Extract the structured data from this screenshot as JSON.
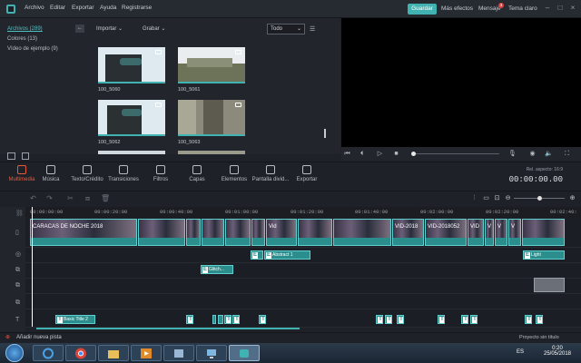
{
  "menubar": {
    "items": [
      "Archivo",
      "Editar",
      "Exportar",
      "Ayuda",
      "Registrarse"
    ],
    "save_label": "Guardar",
    "more_effects": "Más efectos",
    "messages": "Mensaje",
    "messages_badge": "3",
    "theme": "Tema claro"
  },
  "library": {
    "sidebar": [
      "Archivos (289)",
      "Colores (13)",
      "Vídeo de ejemplo (9)"
    ],
    "import_label": "Importar",
    "record_label": "Grabar",
    "filter_value": "Todo",
    "clips": [
      {
        "label": "100_5060"
      },
      {
        "label": "100_5061"
      },
      {
        "label": "100_5062"
      },
      {
        "label": "100_5063"
      }
    ]
  },
  "modules": [
    {
      "label": "Multimedia",
      "active": true
    },
    {
      "label": "Música"
    },
    {
      "label": "Texto/Crédito"
    },
    {
      "label": "Transiciones"
    },
    {
      "label": "Filtros"
    },
    {
      "label": "Capas"
    },
    {
      "label": "Elementos"
    },
    {
      "label": "Pantalla divid..."
    },
    {
      "label": "Exportar"
    }
  ],
  "preview": {
    "aspect_label": "Rel. aspecto: 16:9",
    "timecode": "00:00:00.00"
  },
  "timeline": {
    "ruler": [
      "00:00:00:00",
      "00:00:20:00",
      "00:00:40:00",
      "00:01:00:00",
      "00:01:20:00",
      "00:01:40:00",
      "00:02:00:00",
      "00:02:20:00",
      "00:02:40:"
    ],
    "video_clips": [
      "CARACAS DE NOCHE 2018",
      "",
      "",
      "",
      "",
      "Vid",
      "",
      "",
      "VID-2018",
      "VID-2018052",
      "VID",
      "V",
      "V",
      "V"
    ],
    "text_clips": {
      "row1": [
        "",
        "Abstract 1"
      ],
      "row1b": "Light",
      "row2": "Glitch...",
      "row_titles": [
        "Basic Title 2"
      ]
    },
    "add_track": "Añadir nueva pista",
    "project_name": "Proyecto sin título"
  },
  "taskbar": {
    "lang": "ES",
    "time": "0:20",
    "date": "25/05/2018"
  },
  "colors": {
    "accent": "#3fb2b1",
    "active_module": "#e45b3e",
    "clip": "#2c8d8d"
  }
}
